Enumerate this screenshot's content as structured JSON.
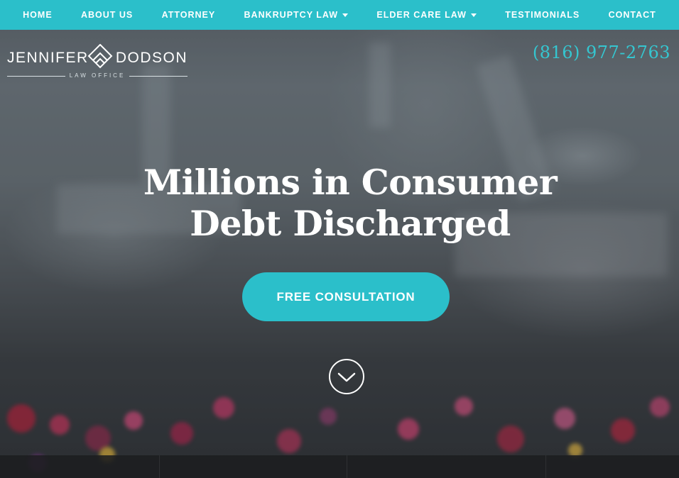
{
  "colors": {
    "accent": "#2bbfca",
    "phone": "#35c6d0",
    "text_light": "#ffffff"
  },
  "nav": {
    "items": [
      {
        "label": "HOME",
        "has_dropdown": false
      },
      {
        "label": "ABOUT US",
        "has_dropdown": false
      },
      {
        "label": "ATTORNEY",
        "has_dropdown": false
      },
      {
        "label": "BANKRUPTCY LAW",
        "has_dropdown": true
      },
      {
        "label": "ELDER CARE LAW",
        "has_dropdown": true
      },
      {
        "label": "TESTIMONIALS",
        "has_dropdown": false
      },
      {
        "label": "CONTACT",
        "has_dropdown": false
      }
    ]
  },
  "logo": {
    "name_left": "JENNIFER",
    "name_right": "DODSON",
    "subtitle": "LAW OFFICE"
  },
  "header": {
    "phone": "(816) 977-2763"
  },
  "hero": {
    "headline_line1": "Millions in Consumer",
    "headline_line2": "Debt Discharged",
    "cta_label": "FREE CONSULTATION",
    "scroll_icon": "chevron-down-icon"
  }
}
